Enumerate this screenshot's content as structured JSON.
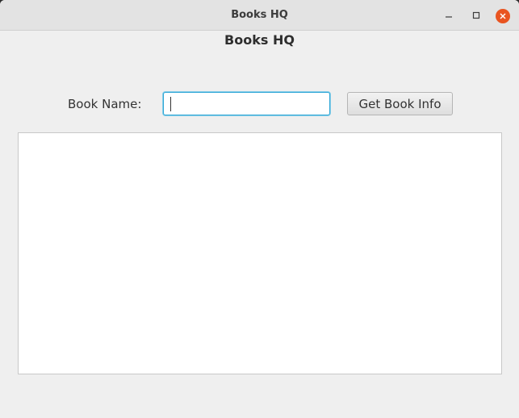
{
  "window": {
    "title": "Books HQ"
  },
  "app": {
    "heading": "Books HQ"
  },
  "form": {
    "book_name_label": "Book Name:",
    "book_name_value": "",
    "get_button_label": "Get Book Info"
  },
  "result": {
    "text": ""
  },
  "colors": {
    "close_button": "#e95420",
    "focus_ring": "#2fa7d6",
    "window_bg": "#efefef"
  },
  "icons": {
    "minimize": "minimize-icon",
    "maximize": "maximize-icon",
    "close": "close-icon"
  }
}
